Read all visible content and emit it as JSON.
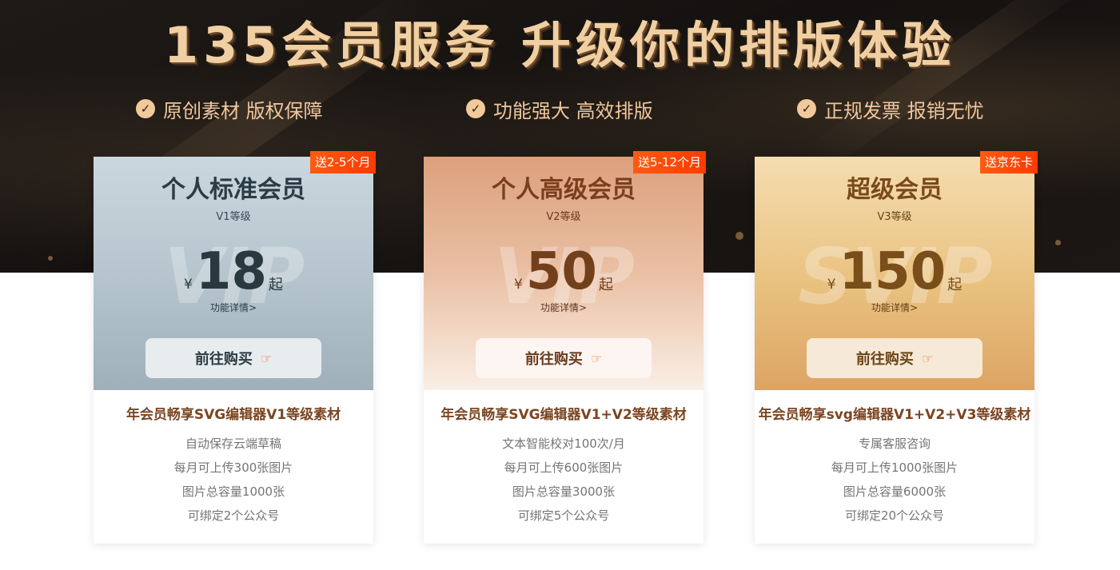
{
  "header": {
    "title": "135会员服务 升级你的排版体验",
    "features": [
      {
        "icon": "check-circle-icon",
        "label": "原创素材 版权保障"
      },
      {
        "icon": "check-circle-icon",
        "label": "功能强大 高效排版"
      },
      {
        "icon": "check-circle-icon",
        "label": "正规发票 报销无忧"
      }
    ]
  },
  "plans": [
    {
      "badge": "送2-5个月",
      "name": "个人标准会员",
      "level": "V1等级",
      "watermark": "VIP",
      "currency": "¥",
      "price": "18",
      "price_suffix": "起",
      "details_link": "功能详情>",
      "buy_label": "前往购买",
      "benefit_title": "年会员畅享SVG编辑器V1等级素材",
      "benefits": [
        "自动保存云端草稿",
        "每月可上传300张图片",
        "图片总容量1000张",
        "可绑定2个公众号"
      ]
    },
    {
      "badge": "送5-12个月",
      "name": "个人高级会员",
      "level": "V2等级",
      "watermark": "VIP",
      "currency": "¥",
      "price": "50",
      "price_suffix": "起",
      "details_link": "功能详情>",
      "buy_label": "前往购买",
      "benefit_title": "年会员畅享SVG编辑器V1+V2等级素材",
      "benefits": [
        "文本智能校对100次/月",
        "每月可上传600张图片",
        "图片总容量3000张",
        "可绑定5个公众号"
      ]
    },
    {
      "badge": "送京东卡",
      "name": "超级会员",
      "level": "V3等级",
      "watermark": "SVIP",
      "currency": "¥",
      "price": "150",
      "price_suffix": "起",
      "details_link": "功能详情>",
      "buy_label": "前往购买",
      "benefit_title": "年会员畅享svg编辑器V1+V2+V3等级素材",
      "benefits": [
        "专属客服咨询",
        "每月可上传1000张图片",
        "图片总容量6000张",
        "可绑定20个公众号"
      ]
    }
  ],
  "colors": {
    "hero_bg": "#141110",
    "title_gold": "#f0cfa3",
    "badge_orange": "#ff4a08",
    "benefit_title": "#7a4522",
    "benefit_text": "#757575"
  }
}
